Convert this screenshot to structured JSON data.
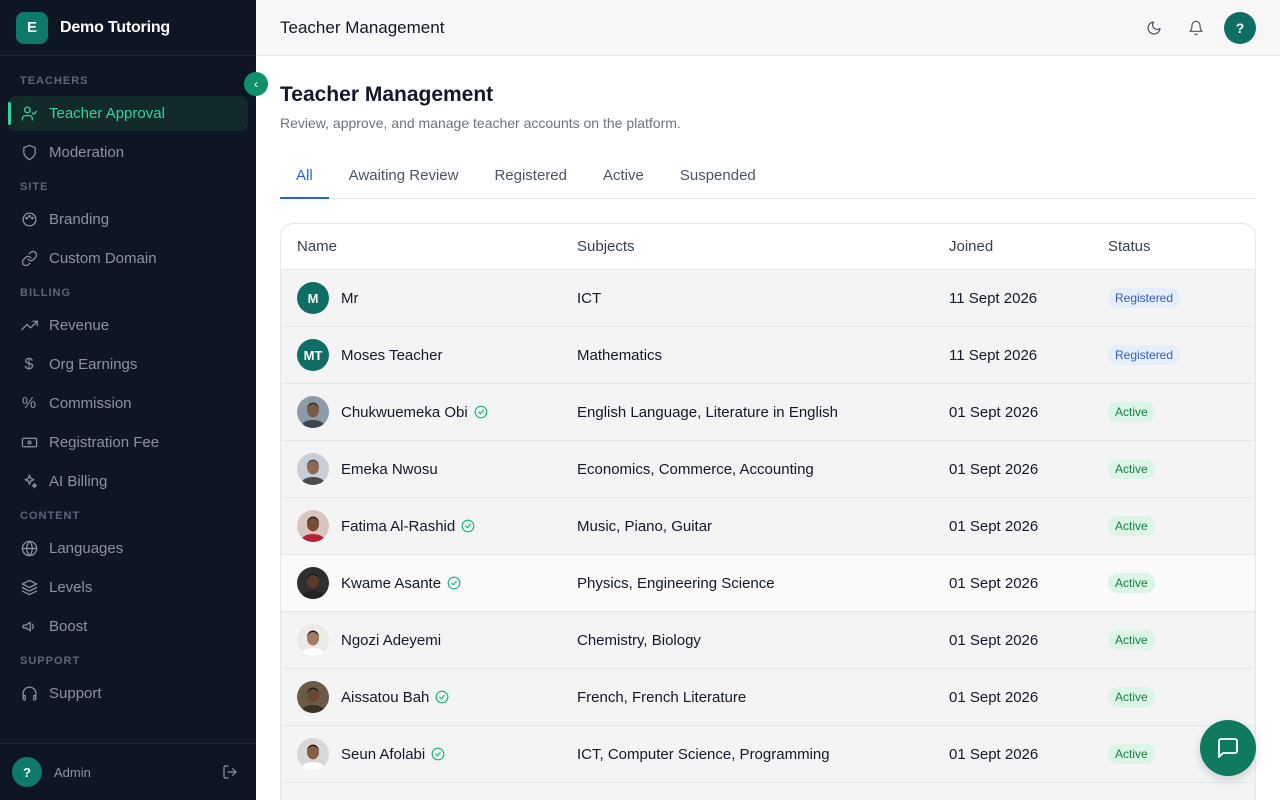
{
  "brand": {
    "logo_letter": "E",
    "name": "Demo Tutoring"
  },
  "sidebar": {
    "sections": [
      {
        "label": "TEACHERS",
        "items": [
          {
            "label": "Teacher Approval",
            "icon": "user-check-icon",
            "active": true
          },
          {
            "label": "Moderation",
            "icon": "shield-icon"
          }
        ]
      },
      {
        "label": "SITE",
        "items": [
          {
            "label": "Branding",
            "icon": "palette-icon"
          },
          {
            "label": "Custom Domain",
            "icon": "link-icon"
          }
        ]
      },
      {
        "label": "BILLING",
        "items": [
          {
            "label": "Revenue",
            "icon": "trending-up-icon"
          },
          {
            "label": "Org Earnings",
            "icon": "dollar-icon"
          },
          {
            "label": "Commission",
            "icon": "percent-icon"
          },
          {
            "label": "Registration Fee",
            "icon": "ticket-icon"
          },
          {
            "label": "AI Billing",
            "icon": "sparkles-icon"
          }
        ]
      },
      {
        "label": "CONTENT",
        "items": [
          {
            "label": "Languages",
            "icon": "globe-icon"
          },
          {
            "label": "Levels",
            "icon": "layers-icon"
          },
          {
            "label": "Boost",
            "icon": "megaphone-icon"
          }
        ]
      },
      {
        "label": "SUPPORT",
        "items": [
          {
            "label": "Support",
            "icon": "headphones-icon"
          }
        ]
      }
    ],
    "footer": {
      "avatar_letter": "?",
      "name": "Admin"
    }
  },
  "topbar": {
    "title": "Teacher Management",
    "help_letter": "?"
  },
  "main": {
    "title": "Teacher Management",
    "subtitle": "Review, approve, and manage teacher accounts on the platform.",
    "tabs": [
      "All",
      "Awaiting Review",
      "Registered",
      "Active",
      "Suspended"
    ],
    "active_tab": 0,
    "table": {
      "columns": [
        "Name",
        "Subjects",
        "Joined",
        "Status"
      ],
      "rows": [
        {
          "name": "Mr",
          "initials": "M",
          "verified": false,
          "subjects": "ICT",
          "joined": "11 Sept 2026",
          "status": "Registered"
        },
        {
          "name": "Moses Teacher",
          "initials": "MT",
          "verified": false,
          "subjects": "Mathematics",
          "joined": "11 Sept 2026",
          "status": "Registered"
        },
        {
          "name": "Chukwuemeka Obi",
          "photo": true,
          "verified": true,
          "subjects": "English Language, Literature in English",
          "joined": "01 Sept 2026",
          "status": "Active"
        },
        {
          "name": "Emeka Nwosu",
          "photo": true,
          "verified": false,
          "subjects": "Economics, Commerce, Accounting",
          "joined": "01 Sept 2026",
          "status": "Active"
        },
        {
          "name": "Fatima Al-Rashid",
          "photo": true,
          "verified": true,
          "subjects": "Music, Piano, Guitar",
          "joined": "01 Sept 2026",
          "status": "Active"
        },
        {
          "name": "Kwame Asante",
          "photo": true,
          "verified": true,
          "subjects": "Physics, Engineering Science",
          "joined": "01 Sept 2026",
          "status": "Active"
        },
        {
          "name": "Ngozi Adeyemi",
          "photo": true,
          "verified": false,
          "subjects": "Chemistry, Biology",
          "joined": "01 Sept 2026",
          "status": "Active"
        },
        {
          "name": "Aissatou Bah",
          "photo": true,
          "verified": true,
          "subjects": "French, French Literature",
          "joined": "01 Sept 2026",
          "status": "Active"
        },
        {
          "name": "Seun Afolabi",
          "photo": true,
          "verified": true,
          "subjects": "ICT, Computer Science, Programming",
          "joined": "01 Sept 2026",
          "status": "Active"
        }
      ]
    }
  },
  "colors": {
    "sidebar_bg": "#0f1623",
    "accent_green": "#34d399",
    "brand_teal": "#0f7a6c",
    "tab_blue": "#2563eb"
  }
}
